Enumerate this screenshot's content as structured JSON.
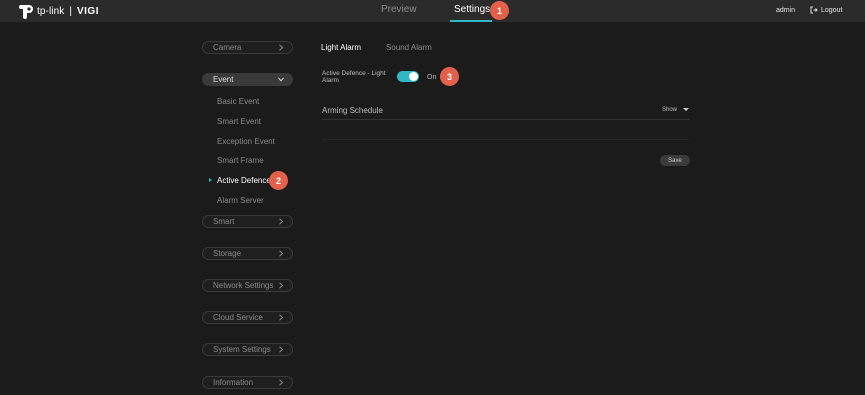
{
  "header": {
    "logo_text": "tp-link",
    "logo_product": "VIGI",
    "nav_tabs": [
      {
        "label": "Preview",
        "active": false
      },
      {
        "label": "Settings",
        "active": true
      }
    ],
    "user": "admin",
    "logout_label": "Logout"
  },
  "badges": [
    "1",
    "2",
    "3"
  ],
  "sidebar": {
    "sections": [
      {
        "label": "Camera",
        "expanded": false
      },
      {
        "label": "Event",
        "expanded": true
      },
      {
        "label": "Smart",
        "expanded": false
      },
      {
        "label": "Storage",
        "expanded": false
      },
      {
        "label": "Network Settings",
        "expanded": false
      },
      {
        "label": "Cloud Service",
        "expanded": false
      },
      {
        "label": "System Settings",
        "expanded": false
      },
      {
        "label": "Information",
        "expanded": false
      }
    ],
    "event_items": [
      {
        "label": "Basic Event",
        "active": false
      },
      {
        "label": "Smart Event",
        "active": false
      },
      {
        "label": "Exception Event",
        "active": false
      },
      {
        "label": "Smart Frame",
        "active": false
      },
      {
        "label": "Active Defence",
        "active": true
      },
      {
        "label": "Alarm Server",
        "active": false
      }
    ]
  },
  "main": {
    "tabs": [
      {
        "label": "Light Alarm",
        "active": true
      },
      {
        "label": "Sound Alarm",
        "active": false
      }
    ],
    "toggle": {
      "label": "Active Defence - Light Alarm",
      "state_text": "On",
      "enabled": true
    },
    "arming_schedule": {
      "title": "Arming Schedule",
      "show_label": "Show"
    },
    "save_label": "Save"
  },
  "colors": {
    "accent": "#2fb8c3",
    "badge": "#e3604a",
    "background": "#1b1b1b",
    "topbar": "#2b2b2b"
  }
}
